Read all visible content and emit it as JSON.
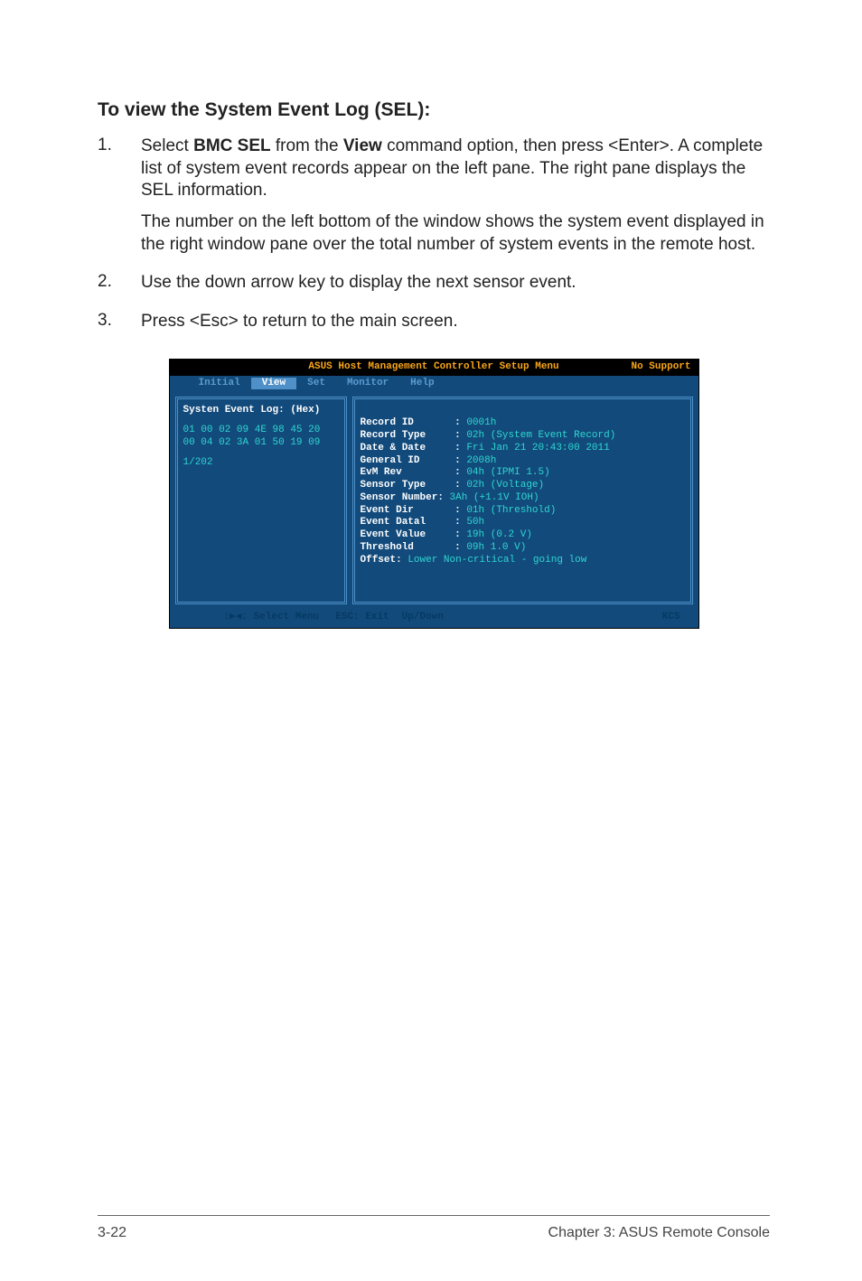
{
  "heading": "To view the System Event Log (SEL):",
  "steps": [
    {
      "num": "1.",
      "pre": "Select ",
      "b1": "BMC SEL",
      "mid": " from the ",
      "b2": "View",
      "post": " command option, then press <Enter>. A complete list of system event records appear on the left pane. The right pane displays the SEL information."
    },
    {
      "num": "2.",
      "text": "Use the down arrow key to display the next sensor event."
    },
    {
      "num": "3.",
      "text": "Press <Esc> to return to the main screen."
    }
  ],
  "note": "The number on the left bottom of the window shows the system event displayed in the right window pane over the total number of system events in the remote host.",
  "term": {
    "title": "ASUS Host Management Controller Setup Menu",
    "title_right": "No Support",
    "menu": [
      "Initial",
      "View",
      "Set",
      "Monitor",
      "Help"
    ],
    "menu_hl_index": 1,
    "left": {
      "title": "Systen Event Log: (Hex)",
      "rows": [
        "01 00 02 09 4E 98 45 20",
        "00 04 02 3A 01 50 19 09"
      ],
      "count": "1/202"
    },
    "right": [
      {
        "k": "Record ID",
        "v": "0001h"
      },
      {
        "k": "Record Type",
        "v": "02h (System Event Record)"
      },
      {
        "k": "Date & Date",
        "v": "Fri Jan 21 20:43:00 2011"
      },
      {
        "k": "General ID",
        "v": "2008h"
      },
      {
        "k": "EvM Rev",
        "v": "04h (IPMI 1.5)"
      },
      {
        "k": "Sensor Type",
        "v": "02h (Voltage)"
      },
      {
        "k": "Sensor Number",
        "v": "3Ah (+1.1V IOH)",
        "nosep": true
      },
      {
        "k": "Event Dir",
        "v": "01h (Threshold)"
      },
      {
        "k": "Event Datal",
        "v": "50h"
      },
      {
        "k": "Event Value",
        "v": "19h (0.2 V)"
      },
      {
        "k": "Threshold",
        "v": "09h 1.0 V)"
      }
    ],
    "offset_label": "Offset: ",
    "offset_val": "Lower Non-critical - going low",
    "footer": {
      "arrows": "↕▶◀:",
      "select": "Select Menu",
      "esc": "ESC:",
      "exit": "Exit",
      "updown": "Up/Down",
      "right": "KCS"
    }
  },
  "page_num": "3-22",
  "chapter": "Chapter 3: ASUS Remote Console"
}
